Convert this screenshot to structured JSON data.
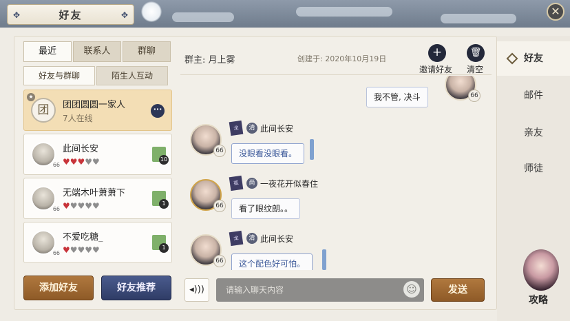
{
  "window": {
    "title": "好友",
    "close_icon": "close-icon"
  },
  "left": {
    "tabs": [
      "最近",
      "联系人",
      "群聊"
    ],
    "subtabs": [
      "好友与群聊",
      "陌生人互动"
    ],
    "list": [
      {
        "name": "团团圆圆一家人",
        "sub": "7人在线",
        "avatar_text": "团",
        "icon": "more-icon"
      },
      {
        "name": "此间长安",
        "level": "66",
        "gift": "10"
      },
      {
        "name": "无端木叶萧萧下",
        "level": "66",
        "gift": "1"
      },
      {
        "name": "不爱吃糖_",
        "level": "66",
        "gift": "1"
      }
    ],
    "add_button": "添加好友",
    "recommend_button": "好友推荐"
  },
  "chat": {
    "owner": "群主: 月上雾",
    "created": "创建于: 2020年10月19日",
    "invite_label": "邀请好友",
    "clear_label": "清空",
    "messages": [
      {
        "side": "right",
        "text": "我不管, 决斗",
        "level": "66"
      },
      {
        "side": "left",
        "sender": "此间长安",
        "badge": "清",
        "text": "没眼看没眼看。",
        "level": "66"
      },
      {
        "side": "left",
        "sender": "一夜花开似春住",
        "badge": "尚",
        "text": "看了眼纹朗。。",
        "level": "66"
      },
      {
        "side": "left",
        "sender": "此间长安",
        "badge": "清",
        "text": "这个配色好可怕。",
        "level": "66"
      }
    ],
    "input_placeholder": "请输入聊天内容",
    "send_button": "发送"
  },
  "side_nav": {
    "items": [
      "好友",
      "邮件",
      "亲友",
      "师徒"
    ],
    "guide_label": "攻略"
  },
  "colors": {
    "accent_brown": "#8e5a27",
    "accent_navy": "#2f3c66",
    "selected_card": "#f3deb5"
  }
}
